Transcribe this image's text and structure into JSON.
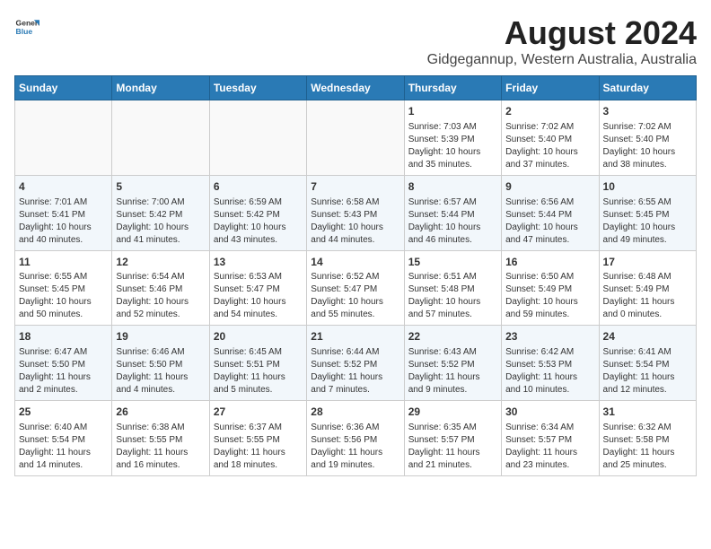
{
  "header": {
    "logo_line1": "General",
    "logo_line2": "Blue",
    "month_year": "August 2024",
    "location": "Gidgegannup, Western Australia, Australia"
  },
  "days_of_week": [
    "Sunday",
    "Monday",
    "Tuesday",
    "Wednesday",
    "Thursday",
    "Friday",
    "Saturday"
  ],
  "weeks": [
    [
      {
        "day": "",
        "info": ""
      },
      {
        "day": "",
        "info": ""
      },
      {
        "day": "",
        "info": ""
      },
      {
        "day": "",
        "info": ""
      },
      {
        "day": "1",
        "info": "Sunrise: 7:03 AM\nSunset: 5:39 PM\nDaylight: 10 hours\nand 35 minutes."
      },
      {
        "day": "2",
        "info": "Sunrise: 7:02 AM\nSunset: 5:40 PM\nDaylight: 10 hours\nand 37 minutes."
      },
      {
        "day": "3",
        "info": "Sunrise: 7:02 AM\nSunset: 5:40 PM\nDaylight: 10 hours\nand 38 minutes."
      }
    ],
    [
      {
        "day": "4",
        "info": "Sunrise: 7:01 AM\nSunset: 5:41 PM\nDaylight: 10 hours\nand 40 minutes."
      },
      {
        "day": "5",
        "info": "Sunrise: 7:00 AM\nSunset: 5:42 PM\nDaylight: 10 hours\nand 41 minutes."
      },
      {
        "day": "6",
        "info": "Sunrise: 6:59 AM\nSunset: 5:42 PM\nDaylight: 10 hours\nand 43 minutes."
      },
      {
        "day": "7",
        "info": "Sunrise: 6:58 AM\nSunset: 5:43 PM\nDaylight: 10 hours\nand 44 minutes."
      },
      {
        "day": "8",
        "info": "Sunrise: 6:57 AM\nSunset: 5:44 PM\nDaylight: 10 hours\nand 46 minutes."
      },
      {
        "day": "9",
        "info": "Sunrise: 6:56 AM\nSunset: 5:44 PM\nDaylight: 10 hours\nand 47 minutes."
      },
      {
        "day": "10",
        "info": "Sunrise: 6:55 AM\nSunset: 5:45 PM\nDaylight: 10 hours\nand 49 minutes."
      }
    ],
    [
      {
        "day": "11",
        "info": "Sunrise: 6:55 AM\nSunset: 5:45 PM\nDaylight: 10 hours\nand 50 minutes."
      },
      {
        "day": "12",
        "info": "Sunrise: 6:54 AM\nSunset: 5:46 PM\nDaylight: 10 hours\nand 52 minutes."
      },
      {
        "day": "13",
        "info": "Sunrise: 6:53 AM\nSunset: 5:47 PM\nDaylight: 10 hours\nand 54 minutes."
      },
      {
        "day": "14",
        "info": "Sunrise: 6:52 AM\nSunset: 5:47 PM\nDaylight: 10 hours\nand 55 minutes."
      },
      {
        "day": "15",
        "info": "Sunrise: 6:51 AM\nSunset: 5:48 PM\nDaylight: 10 hours\nand 57 minutes."
      },
      {
        "day": "16",
        "info": "Sunrise: 6:50 AM\nSunset: 5:49 PM\nDaylight: 10 hours\nand 59 minutes."
      },
      {
        "day": "17",
        "info": "Sunrise: 6:48 AM\nSunset: 5:49 PM\nDaylight: 11 hours\nand 0 minutes."
      }
    ],
    [
      {
        "day": "18",
        "info": "Sunrise: 6:47 AM\nSunset: 5:50 PM\nDaylight: 11 hours\nand 2 minutes."
      },
      {
        "day": "19",
        "info": "Sunrise: 6:46 AM\nSunset: 5:50 PM\nDaylight: 11 hours\nand 4 minutes."
      },
      {
        "day": "20",
        "info": "Sunrise: 6:45 AM\nSunset: 5:51 PM\nDaylight: 11 hours\nand 5 minutes."
      },
      {
        "day": "21",
        "info": "Sunrise: 6:44 AM\nSunset: 5:52 PM\nDaylight: 11 hours\nand 7 minutes."
      },
      {
        "day": "22",
        "info": "Sunrise: 6:43 AM\nSunset: 5:52 PM\nDaylight: 11 hours\nand 9 minutes."
      },
      {
        "day": "23",
        "info": "Sunrise: 6:42 AM\nSunset: 5:53 PM\nDaylight: 11 hours\nand 10 minutes."
      },
      {
        "day": "24",
        "info": "Sunrise: 6:41 AM\nSunset: 5:54 PM\nDaylight: 11 hours\nand 12 minutes."
      }
    ],
    [
      {
        "day": "25",
        "info": "Sunrise: 6:40 AM\nSunset: 5:54 PM\nDaylight: 11 hours\nand 14 minutes."
      },
      {
        "day": "26",
        "info": "Sunrise: 6:38 AM\nSunset: 5:55 PM\nDaylight: 11 hours\nand 16 minutes."
      },
      {
        "day": "27",
        "info": "Sunrise: 6:37 AM\nSunset: 5:55 PM\nDaylight: 11 hours\nand 18 minutes."
      },
      {
        "day": "28",
        "info": "Sunrise: 6:36 AM\nSunset: 5:56 PM\nDaylight: 11 hours\nand 19 minutes."
      },
      {
        "day": "29",
        "info": "Sunrise: 6:35 AM\nSunset: 5:57 PM\nDaylight: 11 hours\nand 21 minutes."
      },
      {
        "day": "30",
        "info": "Sunrise: 6:34 AM\nSunset: 5:57 PM\nDaylight: 11 hours\nand 23 minutes."
      },
      {
        "day": "31",
        "info": "Sunrise: 6:32 AM\nSunset: 5:58 PM\nDaylight: 11 hours\nand 25 minutes."
      }
    ]
  ]
}
